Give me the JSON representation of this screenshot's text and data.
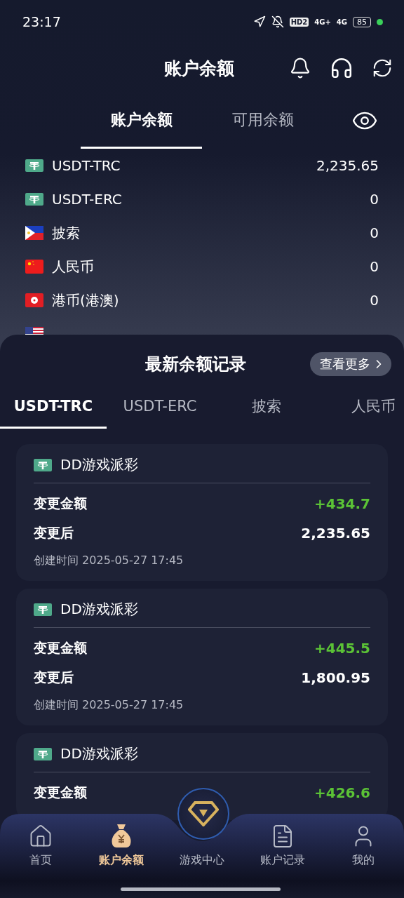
{
  "status_bar": {
    "time": "23:17",
    "hd_badge": "HD2",
    "signal_1": "4G+",
    "signal_2": "4G",
    "battery": "85"
  },
  "header": {
    "title": "账户余额"
  },
  "tabs": [
    {
      "label": "账户余额",
      "selected": true
    },
    {
      "label": "可用余额",
      "selected": false
    }
  ],
  "balances": [
    {
      "kind": "usdt",
      "name": "USDT-TRC",
      "amount": "2,235.65"
    },
    {
      "kind": "usdt",
      "name": "USDT-ERC",
      "amount": "0"
    },
    {
      "kind": "ph",
      "name": "披索",
      "amount": "0"
    },
    {
      "kind": "cn",
      "name": "人民币",
      "amount": "0"
    },
    {
      "kind": "hk",
      "name": "港币(港澳)",
      "amount": "0"
    },
    {
      "kind": "us"
    }
  ],
  "records": {
    "title": "最新余额记录",
    "more_button": "查看更多",
    "tabs": [
      {
        "label": "USDT-TRC",
        "selected": true
      },
      {
        "label": "USDT-ERC",
        "selected": false
      },
      {
        "label": "披索",
        "selected": false
      },
      {
        "label": "人民币",
        "selected": false
      }
    ],
    "items": [
      {
        "kind": "usdt",
        "source": "DD游戏派彩",
        "change_label": "变更金额",
        "change": "+434.7",
        "after_label": "变更后",
        "after": "2,235.65",
        "created": "创建时间 2025-05-27 17:45"
      },
      {
        "kind": "usdt",
        "source": "DD游戏派彩",
        "change_label": "变更金额",
        "change": "+445.5",
        "after_label": "变更后",
        "after": "1,800.95",
        "created": "创建时间 2025-05-27 17:45"
      },
      {
        "kind": "usdt",
        "source": "DD游戏派彩",
        "change_label": "变更金额",
        "change": "+426.6"
      }
    ]
  },
  "bottom_nav": [
    {
      "kind": "home",
      "label": "首页",
      "selected": false
    },
    {
      "kind": "bag",
      "label": "账户余额",
      "selected": true
    },
    {
      "kind": "game",
      "label": "游戏中心",
      "selected": false
    },
    {
      "kind": "doc",
      "label": "账户记录",
      "selected": false
    },
    {
      "kind": "user",
      "label": "我的",
      "selected": false
    }
  ]
}
